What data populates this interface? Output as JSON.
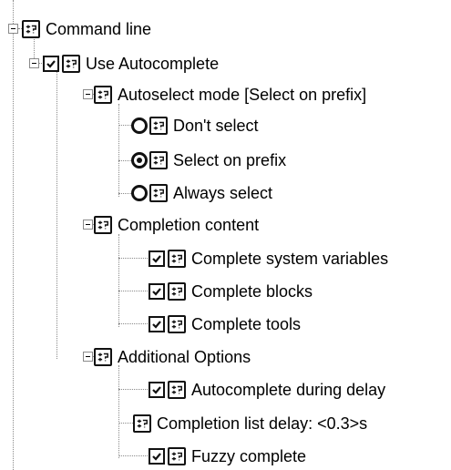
{
  "tree": {
    "command_line": "Command line",
    "use_autocomplete": {
      "label": "Use Autocomplete",
      "checked": true
    },
    "autoselect": {
      "label": "Autoselect mode [Select on prefix]",
      "options": [
        {
          "label": "Don't select",
          "selected": false
        },
        {
          "label": "Select on prefix",
          "selected": true
        },
        {
          "label": "Always select",
          "selected": false
        }
      ]
    },
    "completion_content": {
      "label": "Completion content",
      "items": [
        {
          "label": "Complete system variables",
          "checked": true
        },
        {
          "label": "Complete blocks",
          "checked": true
        },
        {
          "label": "Complete tools",
          "checked": true
        }
      ]
    },
    "additional_options": {
      "label": "Additional Options",
      "autocomplete_delay": {
        "label": "Autocomplete during delay",
        "checked": true
      },
      "list_delay": "Completion list delay: <0.3>s",
      "fuzzy": {
        "label": "Fuzzy complete",
        "checked": true
      }
    }
  },
  "icons": {
    "property": "property-icon",
    "checkbox": "check-icon",
    "radio": "radio-icon",
    "expander": "collapse-icon"
  }
}
